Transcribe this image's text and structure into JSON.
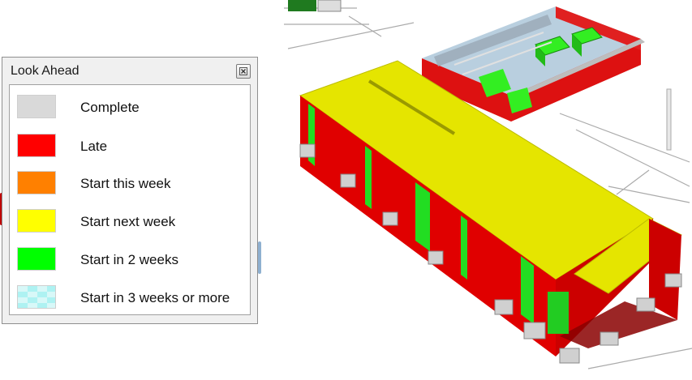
{
  "legend": {
    "title": "Look Ahead",
    "items": [
      {
        "label": "Complete",
        "color": "#d9d9d9",
        "pattern": "solid"
      },
      {
        "label": "Late",
        "color": "#ff0000",
        "pattern": "solid"
      },
      {
        "label": "Start this week",
        "color": "#ff8000",
        "pattern": "solid"
      },
      {
        "label": "Start next week",
        "color": "#ffff00",
        "pattern": "solid"
      },
      {
        "label": "Start in 2 weeks",
        "color": "#00ff00",
        "pattern": "solid"
      },
      {
        "label": "Start in 3 weeks or more",
        "color": "#aef2f2",
        "pattern": "checker"
      }
    ],
    "close_icon": "close-icon"
  },
  "colors": {
    "roof": "#e5e500",
    "wall_red": "#e00000",
    "wall_green": "#22dd22",
    "hvac_green": "#33ee22"
  }
}
